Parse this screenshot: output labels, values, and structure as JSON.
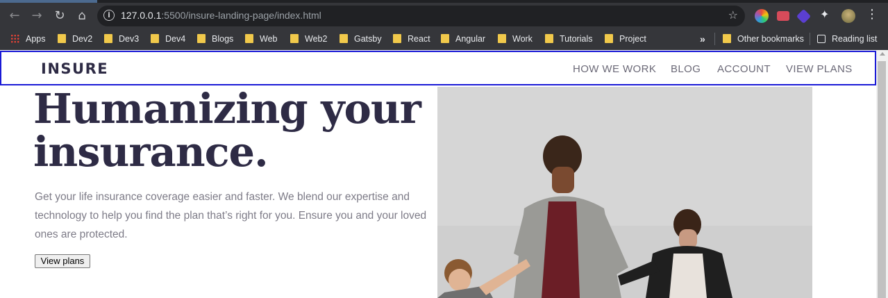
{
  "browser": {
    "url_host": "127.0.0.1",
    "url_rest": ":5500/insure-landing-page/index.html",
    "back_icon": "arrow-left-icon",
    "forward_icon": "arrow-right-icon",
    "reload_icon": "reload-icon",
    "home_icon": "home-icon",
    "bookmarks": [
      {
        "label": "Apps"
      },
      {
        "label": "Dev2"
      },
      {
        "label": "Dev3"
      },
      {
        "label": "Dev4"
      },
      {
        "label": "Blogs"
      },
      {
        "label": "Web"
      },
      {
        "label": "Web2"
      },
      {
        "label": "Gatsby"
      },
      {
        "label": "React"
      },
      {
        "label": "Angular"
      },
      {
        "label": "Work"
      },
      {
        "label": "Tutorials"
      },
      {
        "label": "Project"
      }
    ],
    "overflow": "»",
    "other_bookmarks": "Other bookmarks",
    "reading_list": "Reading list"
  },
  "site": {
    "logo": "INSURE",
    "nav": [
      "HOW WE WORK",
      "BLOG",
      "ACCOUNT",
      "VIEW PLANS"
    ],
    "hero": {
      "title_line1": "Humanizing your",
      "title_line2": "insurance.",
      "text": "Get your life insurance coverage easier and faster. We blend our expertise and technology to help you find the plan that’s right for you. Ensure you and your loved ones are protected.",
      "button": "View plans"
    }
  },
  "colors": {
    "chrome_bg": "#35363a",
    "brand_dark": "#2e2b45",
    "header_outline": "#1a1ad6",
    "body_text": "#7d7b87"
  }
}
